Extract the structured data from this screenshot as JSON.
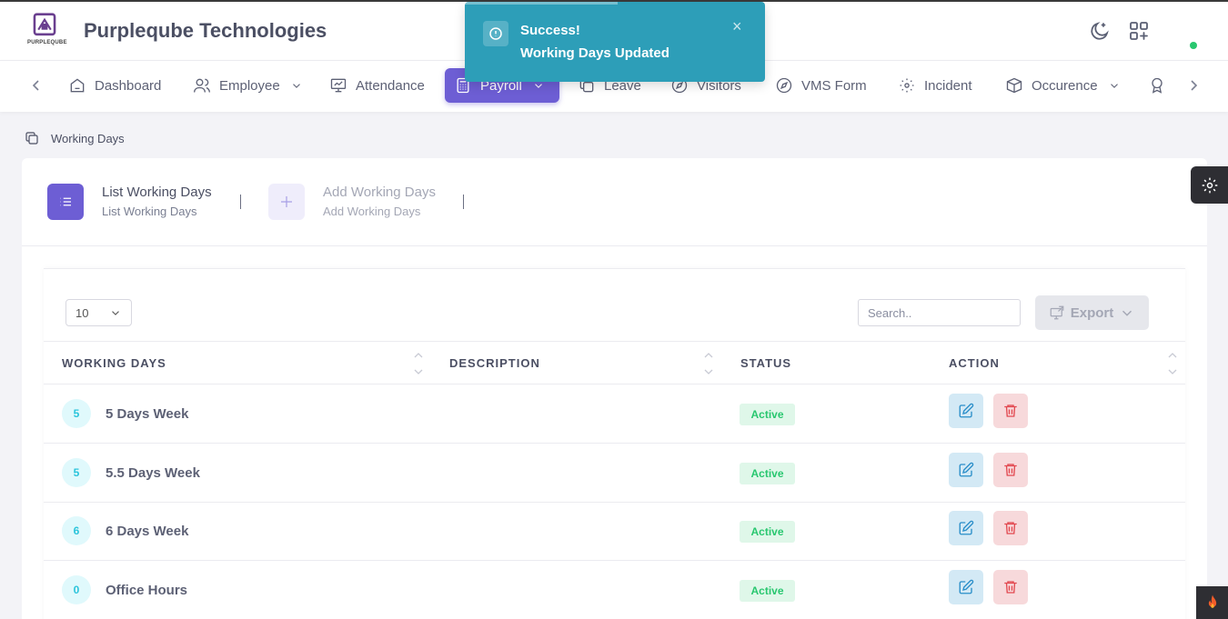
{
  "header": {
    "company": "Purpleqube Technologies",
    "logo_text": "PURPLEQUBE",
    "icons": [
      "moon-icon",
      "apps-add-icon"
    ]
  },
  "nav": {
    "items": [
      {
        "label": "Dashboard",
        "icon": "home-icon"
      },
      {
        "label": "Employee",
        "icon": "users-icon",
        "has_dropdown": true
      },
      {
        "label": "Attendance",
        "icon": "presentation-icon"
      },
      {
        "label": "Payroll",
        "icon": "calculator-icon",
        "has_dropdown": true,
        "active": true
      },
      {
        "label": "Leave",
        "icon": "copy-icon"
      },
      {
        "label": "Visitors",
        "icon": "compass-icon"
      },
      {
        "label": "VMS Form",
        "icon": "compass-icon"
      },
      {
        "label": "Incident",
        "icon": "focus-icon"
      },
      {
        "label": "Occurence",
        "icon": "box-icon",
        "has_dropdown": true
      }
    ]
  },
  "breadcrumb": {
    "label": "Working Days"
  },
  "tabs": [
    {
      "title": "List Working Days",
      "subtitle": "List Working Days",
      "active": true
    },
    {
      "title": "Add Working Days",
      "subtitle": "Add Working Days",
      "active": false
    }
  ],
  "table_controls": {
    "page_size": "10",
    "search_placeholder": "Search..",
    "export_label": "Export"
  },
  "table": {
    "columns": [
      "WORKING DAYS",
      "DESCRIPTION",
      "STATUS",
      "ACTION"
    ],
    "rows": [
      {
        "badge": "5",
        "name": "5 Days Week",
        "description": "",
        "status": "Active"
      },
      {
        "badge": "5",
        "name": "5.5 Days Week",
        "description": "",
        "status": "Active"
      },
      {
        "badge": "6",
        "name": "6 Days Week",
        "description": "",
        "status": "Active"
      },
      {
        "badge": "0",
        "name": "Office Hours",
        "description": "",
        "status": "Active"
      }
    ]
  },
  "toast": {
    "title": "Success!",
    "message": "Working Days Updated",
    "close": "×"
  },
  "colors": {
    "accent": "#6d5ed4",
    "toast": "#2d9eb8",
    "success": "#28c76f",
    "danger": "#e2484f",
    "info": "#2a8ec9"
  }
}
